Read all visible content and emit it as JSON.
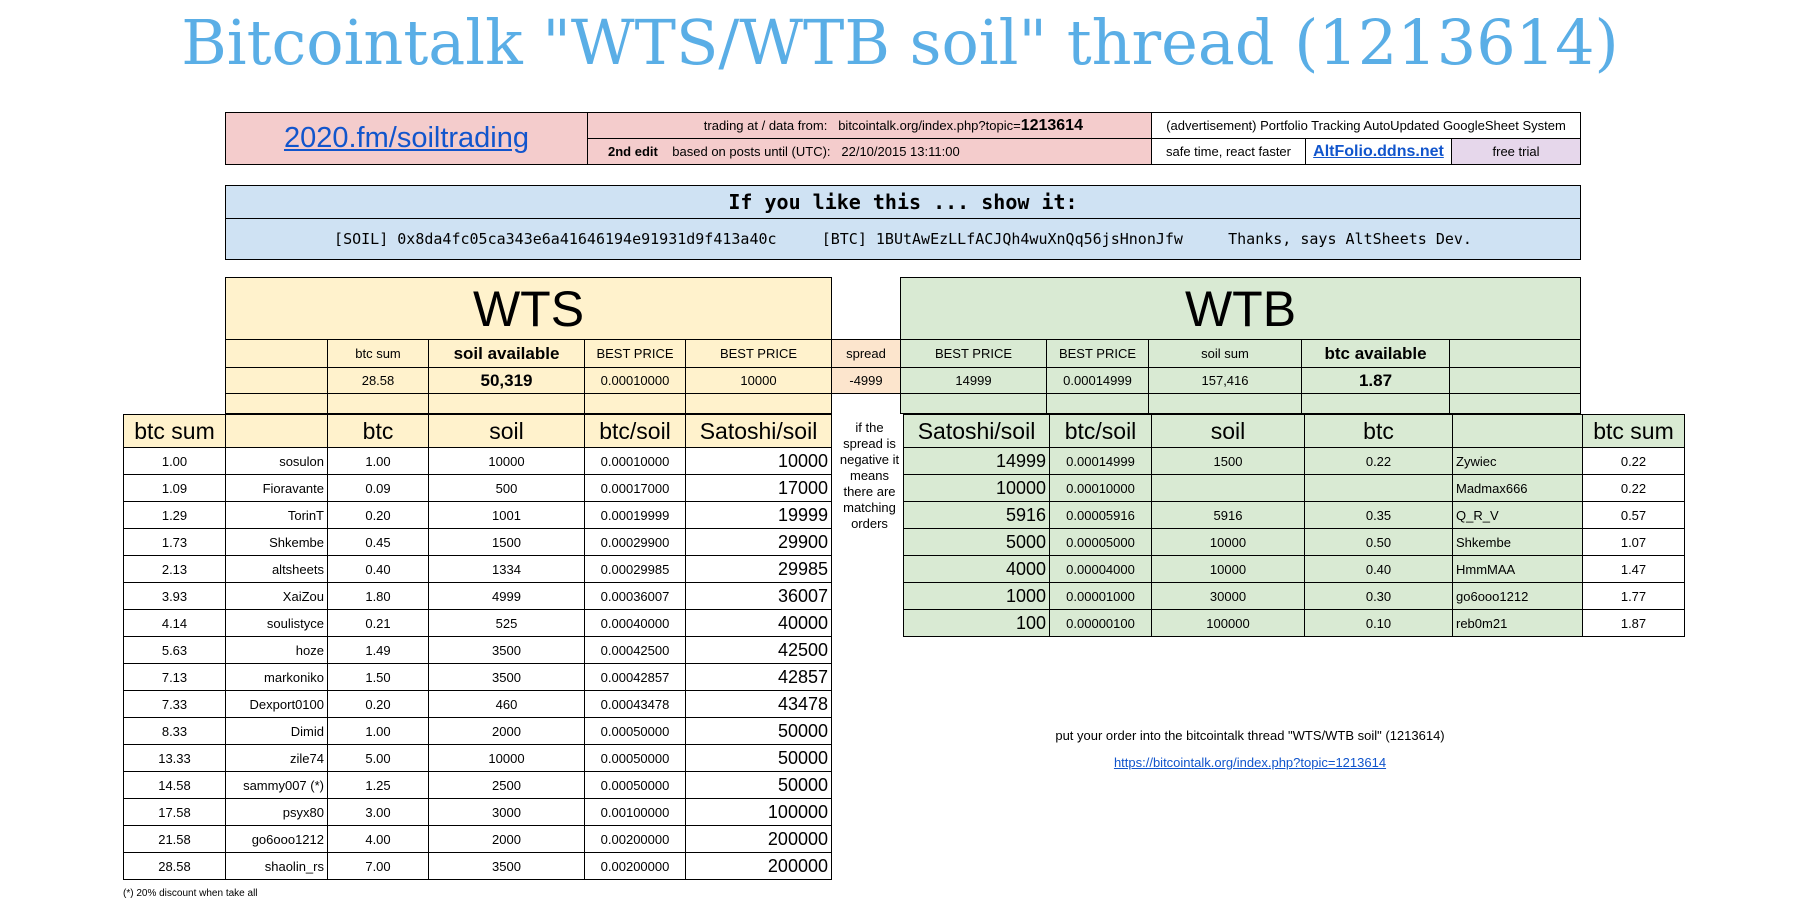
{
  "title": "Bitcointalk \"WTS/WTB soil\" thread (1213614)",
  "header": {
    "site_link": "2020.fm/soiltrading",
    "trading_at_label": "trading at / data from:",
    "source_url": "bitcointalk.org/index.php?topic=",
    "topic_id": "1213614",
    "edit_label": "2nd edit",
    "based_on_label": "based on posts until (UTC):",
    "timestamp": "22/10/2015 13:11:00",
    "ad_text": "(advertisement) Portfolio Tracking AutoUpdated GoogleSheet System",
    "safe_time": "safe time, react faster",
    "altfolio_link": "AltFolio.ddns.net",
    "free_trial": "free trial"
  },
  "donate": {
    "heading": "If you like this ... show it:",
    "soil_label": "[SOIL]",
    "soil_address": "0x8da4fc05ca343e6a41646194e91931d9f413a40c",
    "btc_label": "[BTC]",
    "btc_address": "1BUtAwEzLLfACJQh4wuXnQq56jsHnonJfw",
    "thanks": "Thanks, says AltSheets Dev."
  },
  "wts": {
    "heading": "WTS",
    "summary_headers": [
      "btc sum",
      "soil available",
      "BEST PRICE",
      "BEST PRICE"
    ],
    "summary_values": [
      "28.58",
      "50,319",
      "0.00010000",
      "10000"
    ],
    "columns": [
      "btc sum",
      "btc",
      "soil",
      "btc/soil",
      "Satoshi/soil"
    ],
    "rows": [
      [
        "1.00",
        "sosulon",
        "1.00",
        "10000",
        "0.00010000",
        "10000"
      ],
      [
        "1.09",
        "Fioravante",
        "0.09",
        "500",
        "0.00017000",
        "17000"
      ],
      [
        "1.29",
        "TorinT",
        "0.20",
        "1001",
        "0.00019999",
        "19999"
      ],
      [
        "1.73",
        "Shkembe",
        "0.45",
        "1500",
        "0.00029900",
        "29900"
      ],
      [
        "2.13",
        "altsheets",
        "0.40",
        "1334",
        "0.00029985",
        "29985"
      ],
      [
        "3.93",
        "XaiZou",
        "1.80",
        "4999",
        "0.00036007",
        "36007"
      ],
      [
        "4.14",
        "soulistyce",
        "0.21",
        "525",
        "0.00040000",
        "40000"
      ],
      [
        "5.63",
        "hoze",
        "1.49",
        "3500",
        "0.00042500",
        "42500"
      ],
      [
        "7.13",
        "markoniko",
        "1.50",
        "3500",
        "0.00042857",
        "42857"
      ],
      [
        "7.33",
        "Dexport0100",
        "0.20",
        "460",
        "0.00043478",
        "43478"
      ],
      [
        "8.33",
        "Dimid",
        "1.00",
        "2000",
        "0.00050000",
        "50000"
      ],
      [
        "13.33",
        "zile74",
        "5.00",
        "10000",
        "0.00050000",
        "50000"
      ],
      [
        "14.58",
        "sammy007 (*)",
        "1.25",
        "2500",
        "0.00050000",
        "50000"
      ],
      [
        "17.58",
        "psyx80",
        "3.00",
        "3000",
        "0.00100000",
        "100000"
      ],
      [
        "21.58",
        "go6ooo1212",
        "4.00",
        "2000",
        "0.00200000",
        "200000"
      ],
      [
        "28.58",
        "shaolin_rs",
        "7.00",
        "3500",
        "0.00200000",
        "200000"
      ]
    ],
    "footnote": "(*) 20% discount when take all"
  },
  "spread": {
    "label": "spread",
    "value": "-4999",
    "note": [
      "if the",
      "spread is",
      "negative it",
      "means",
      "there are",
      "matching",
      "orders"
    ]
  },
  "wtb": {
    "heading": "WTB",
    "summary_headers": [
      "BEST PRICE",
      "BEST PRICE",
      "soil sum",
      "btc available"
    ],
    "summary_values": [
      "14999",
      "0.00014999",
      "157,416",
      "1.87"
    ],
    "columns": [
      "Satoshi/soil",
      "btc/soil",
      "soil",
      "btc",
      "btc sum"
    ],
    "rows": [
      [
        "14999",
        "0.00014999",
        "1500",
        "0.22",
        "Zywiec",
        "0.22"
      ],
      [
        "10000",
        "0.00010000",
        "",
        "",
        "Madmax666",
        "0.22"
      ],
      [
        "5916",
        "0.00005916",
        "5916",
        "0.35",
        "Q_R_V",
        "0.57"
      ],
      [
        "5000",
        "0.00005000",
        "10000",
        "0.50",
        "Shkembe",
        "1.07"
      ],
      [
        "4000",
        "0.00004000",
        "10000",
        "0.40",
        "HmmMAA",
        "1.47"
      ],
      [
        "1000",
        "0.00001000",
        "30000",
        "0.30",
        "go6ooo1212",
        "1.77"
      ],
      [
        "100",
        "0.00000100",
        "100000",
        "0.10",
        "reb0m21",
        "1.87"
      ]
    ]
  },
  "order_note": {
    "text": "put your order into the bitcointalk thread \"WTS/WTB soil\" (1213614)",
    "link": "https://bitcointalk.org/index.php?topic=1213614"
  },
  "colors": {
    "title": "#5aaee6",
    "wts_bg": "#fff2cc",
    "wtb_bg": "#d9ead3",
    "header_bg": "#f4cccc",
    "donate_bg": "#cfe2f3",
    "link": "#1155cc"
  }
}
